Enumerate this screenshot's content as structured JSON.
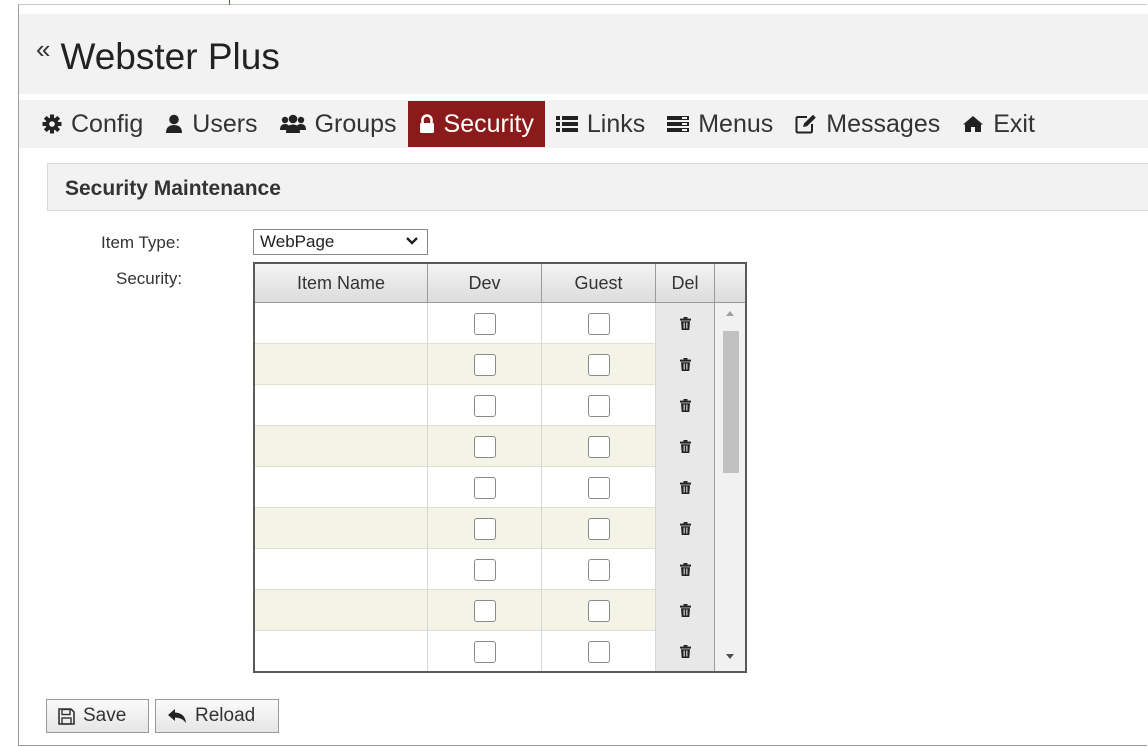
{
  "app": {
    "title": "Webster Plus",
    "collapse_icon": "«"
  },
  "nav": {
    "items": [
      {
        "label": "Config",
        "icon": "gear-icon"
      },
      {
        "label": "Users",
        "icon": "user-icon"
      },
      {
        "label": "Groups",
        "icon": "users-icon"
      },
      {
        "label": "Security",
        "icon": "lock-icon",
        "active": true
      },
      {
        "label": "Links",
        "icon": "list-icon"
      },
      {
        "label": "Menus",
        "icon": "menu-icon"
      },
      {
        "label": "Messages",
        "icon": "edit-icon"
      },
      {
        "label": "Exit",
        "icon": "home-icon"
      }
    ],
    "active_color": "#8b1a1a"
  },
  "section": {
    "title": "Security Maintenance"
  },
  "form": {
    "item_type_label": "Item Type:",
    "item_type_value": "WebPage",
    "security_label": "Security:"
  },
  "grid": {
    "columns": [
      "Item Name",
      "Dev",
      "Guest",
      "Del"
    ],
    "rows": [
      {
        "item_name": "",
        "dev": false,
        "guest": false
      },
      {
        "item_name": "",
        "dev": false,
        "guest": false
      },
      {
        "item_name": "",
        "dev": false,
        "guest": false
      },
      {
        "item_name": "",
        "dev": false,
        "guest": false
      },
      {
        "item_name": "",
        "dev": false,
        "guest": false
      },
      {
        "item_name": "",
        "dev": false,
        "guest": false
      },
      {
        "item_name": "",
        "dev": false,
        "guest": false
      },
      {
        "item_name": "",
        "dev": false,
        "guest": false
      },
      {
        "item_name": "",
        "dev": false,
        "guest": false
      }
    ],
    "row_alt_color": "#f4f4e6"
  },
  "buttons": {
    "save": "Save",
    "reload": "Reload"
  }
}
